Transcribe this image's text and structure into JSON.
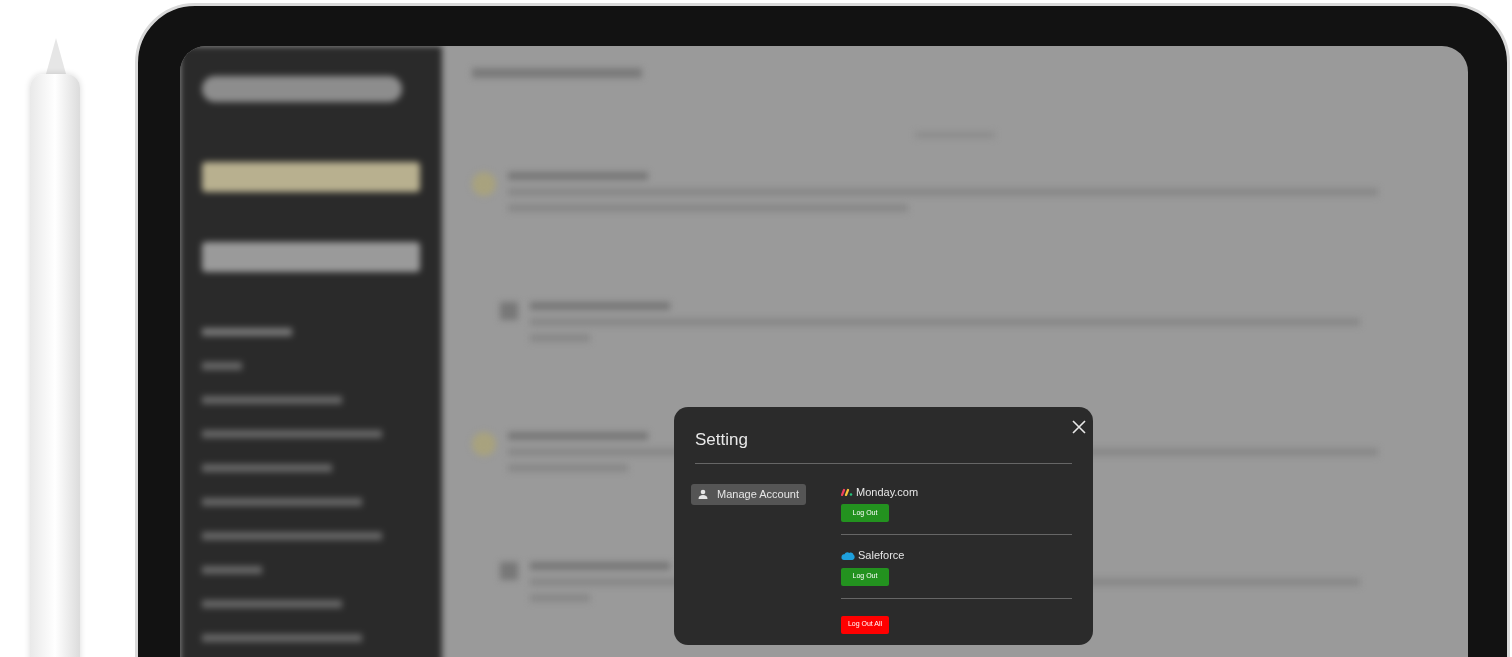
{
  "dialog": {
    "title": "Setting",
    "menu": [
      {
        "label": "Manage Account",
        "selected": true
      }
    ],
    "integrations": [
      {
        "kind": "monday",
        "name": "Monday.com",
        "button": "Log Out"
      },
      {
        "kind": "salesforce",
        "name": "Saleforce",
        "button": "Log Out"
      }
    ],
    "logout_all": "Log Out All"
  }
}
